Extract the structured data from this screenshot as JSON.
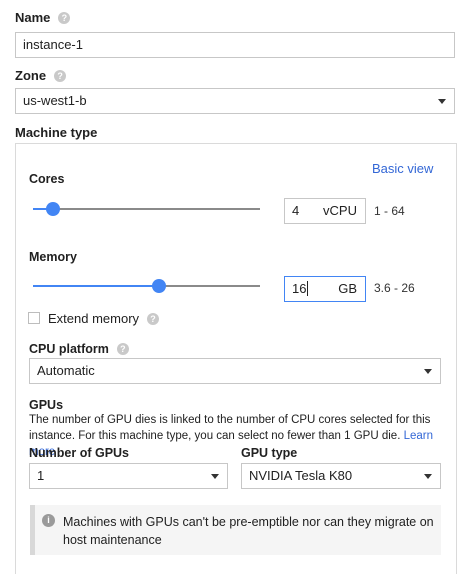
{
  "name": {
    "label": "Name",
    "value": "instance-1"
  },
  "zone": {
    "label": "Zone",
    "value": "us-west1-b"
  },
  "machine_type": {
    "label": "Machine type",
    "basic_view_link": "Basic view",
    "cores": {
      "label": "Cores",
      "value": "4",
      "unit": "vCPU",
      "range": "1 - 64",
      "slider_min": 1,
      "slider_max": 64,
      "slider_value": 4
    },
    "memory": {
      "label": "Memory",
      "value": "16",
      "unit": "GB",
      "range": "3.6 - 26",
      "slider_min": 3.6,
      "slider_max": 26,
      "slider_value": 16
    },
    "extend_memory": {
      "label": "Extend memory",
      "checked": false
    },
    "cpu_platform": {
      "label": "CPU platform",
      "value": "Automatic"
    },
    "gpus": {
      "label": "GPUs",
      "description_line1": "The number of GPU dies is linked to the number of CPU cores selected for this",
      "description_line2": "instance. For this machine type, you can select no fewer than 1 GPU die.",
      "learn_more": "Learn more",
      "number_label": "Number of GPUs",
      "number_value": "1",
      "type_label": "GPU type",
      "type_value": "NVIDIA Tesla K80"
    },
    "notice": {
      "line1": "Machines with GPUs can't be pre-emptible nor can they migrate on",
      "line2": "host maintenance"
    }
  },
  "icons": {
    "help": "help-icon",
    "info": "info-icon",
    "dropdown": "chevron-down-icon"
  },
  "colors": {
    "accent": "#4285f4",
    "link": "#3367d6",
    "border": "#c7c7c7"
  }
}
